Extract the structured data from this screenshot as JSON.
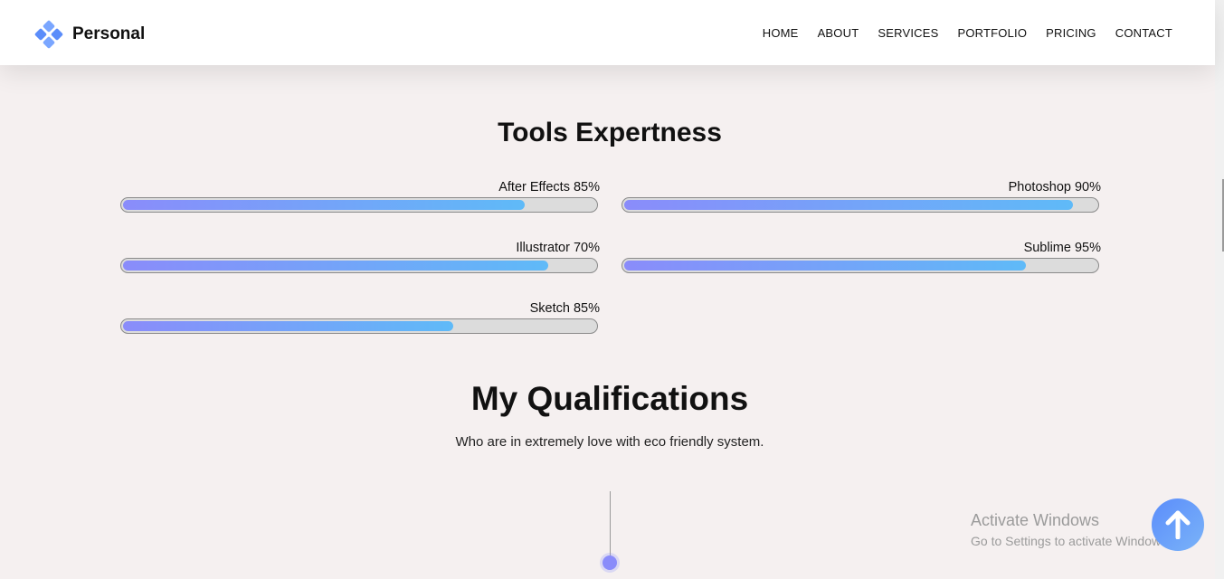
{
  "brand": {
    "name": "Personal",
    "icon": "diamond-logo-icon",
    "color": "#5b8dfa"
  },
  "nav": {
    "items": [
      "HOME",
      "ABOUT",
      "SERVICES",
      "PORTFOLIO",
      "PRICING",
      "CONTACT"
    ]
  },
  "tools": {
    "title": "Tools Expertness",
    "skills": [
      {
        "label": "After Effects 85%",
        "level": 0.85
      },
      {
        "label": "Photoshop 90%",
        "level": 0.95
      },
      {
        "label": "Illustrator 70%",
        "level": 0.9
      },
      {
        "label": "Sublime 95%",
        "level": 0.85
      },
      {
        "label": "Sketch 85%",
        "level": 0.7
      }
    ],
    "bar_gradient": [
      "#8a8cfa",
      "#5fbaf8"
    ]
  },
  "qualifications": {
    "title": "My Qualifications",
    "subtitle": "Who are in extremely love with eco friendly system."
  },
  "watermark": {
    "line1": "Activate Windows",
    "line2": "Go to Settings to activate Windows."
  },
  "scroll_top": {
    "icon": "arrow-up-icon"
  }
}
